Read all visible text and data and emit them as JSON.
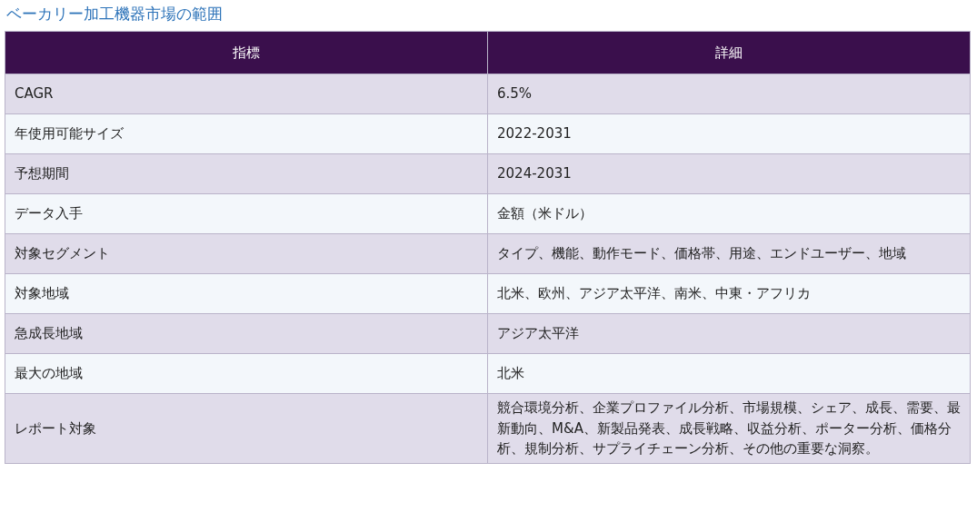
{
  "title": "ベーカリー加工機器市場の範囲",
  "table": {
    "columns": [
      "指標",
      "詳細"
    ],
    "rows": [
      {
        "cells": [
          "CAGR",
          "6.5%"
        ]
      },
      {
        "cells": [
          "年使用可能サイズ",
          "2022-2031"
        ]
      },
      {
        "cells": [
          "予想期間",
          "2024-2031"
        ]
      },
      {
        "cells": [
          "データ入手",
          "金額（米ドル）"
        ]
      },
      {
        "cells": [
          "対象セグメント",
          "タイプ、機能、動作モード、価格帯、用途、エンドユーザー、地域"
        ]
      },
      {
        "cells": [
          "対象地域",
          "北米、欧州、アジア太平洋、南米、中東・アフリカ"
        ]
      },
      {
        "cells": [
          "急成長地域",
          "アジア太平洋"
        ]
      },
      {
        "cells": [
          "最大の地域",
          "北米"
        ]
      },
      {
        "cells": [
          "レポート対象",
          "競合環境分析、企業プロファイル分析、市場規模、シェア、成長、需要、最新動向、M&A、新製品発表、成長戦略、収益分析、ポーター分析、価格分析、規制分析、サプライチェーン分析、その他の重要な洞察。"
        ]
      }
    ]
  }
}
